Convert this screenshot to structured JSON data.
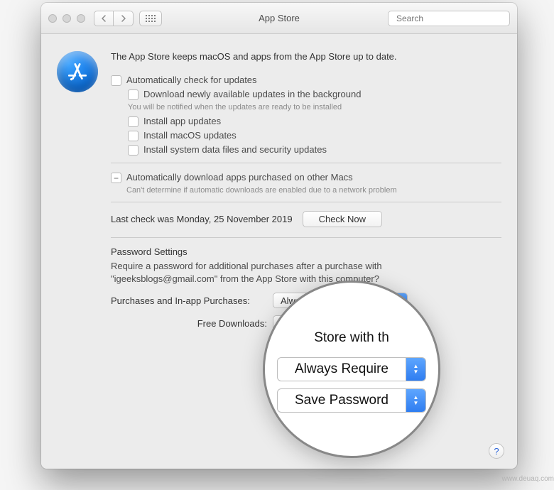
{
  "window": {
    "title": "App Store"
  },
  "search": {
    "placeholder": "Search"
  },
  "intro": "The App Store keeps macOS and apps from the App Store up to date.",
  "check": {
    "auto": "Automatically check for updates",
    "dl": "Download newly available updates in the background",
    "dl_sub": "You will be notified when the updates are ready to be installed",
    "app": "Install app updates",
    "macos": "Install macOS updates",
    "system": "Install system data files and security updates"
  },
  "autodl": {
    "label": "Automatically download apps purchased on other Macs",
    "sub": "Can't determine if automatic downloads are enabled due to a network problem"
  },
  "last_check": "Last check was Monday, 25 November 2019",
  "check_now": "Check Now",
  "pwd": {
    "header": "Password Settings",
    "desc1": "Require a password for additional purchases after a purchase with",
    "desc2": "\"igeeksblogs@gmail.com\" from the App Store with this computer?",
    "row1_label": "Purchases and In-app Purchases:",
    "row2_label": "Free Downloads:",
    "sel1": "Always Require",
    "sel2": "Save Password"
  },
  "mag": {
    "top": "Store with th",
    "opt1": "Always Require",
    "opt2": "Save Password"
  },
  "watermark": "www.deuaq.com"
}
